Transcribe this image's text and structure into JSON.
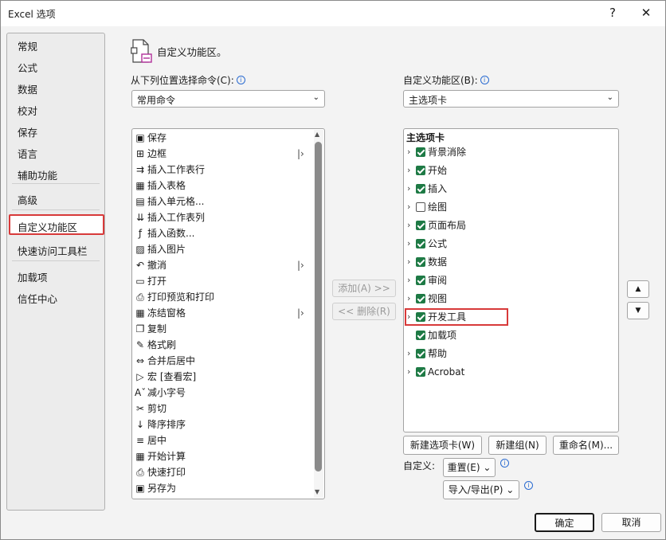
{
  "window": {
    "title": "Excel 选项",
    "help": "?",
    "close": "✕"
  },
  "nav": {
    "items": [
      "常规",
      "公式",
      "数据",
      "校对",
      "保存",
      "语言",
      "辅助功能",
      "高级",
      "自定义功能区",
      "快速访问工具栏",
      "加载项",
      "信任中心"
    ],
    "selected": "自定义功能区"
  },
  "header": {
    "title": "自定义功能区。"
  },
  "left": {
    "label": "从下列位置选择命令(C):",
    "combo_value": "常用命令",
    "commands": [
      {
        "label": "保存",
        "icon": "save-icon",
        "glyph": "▣",
        "arrow": false
      },
      {
        "label": "边框",
        "icon": "border-icon",
        "glyph": "⊞",
        "arrow": true
      },
      {
        "label": "插入工作表行",
        "icon": "insert-row-icon",
        "glyph": "⇉",
        "arrow": false
      },
      {
        "label": "插入表格",
        "icon": "insert-table-icon",
        "glyph": "▦",
        "arrow": false
      },
      {
        "label": "插入单元格...",
        "icon": "insert-cells-icon",
        "glyph": "▤",
        "arrow": false
      },
      {
        "label": "插入工作表列",
        "icon": "insert-column-icon",
        "glyph": "⇊",
        "arrow": false
      },
      {
        "label": "插入函数...",
        "icon": "function-icon",
        "glyph": "ƒ",
        "arrow": false
      },
      {
        "label": "插入图片",
        "icon": "picture-icon",
        "glyph": "▨",
        "arrow": false
      },
      {
        "label": "撤消",
        "icon": "undo-icon",
        "glyph": "↶",
        "arrow": true
      },
      {
        "label": "打开",
        "icon": "open-icon",
        "glyph": "▭",
        "arrow": false
      },
      {
        "label": "打印预览和打印",
        "icon": "print-preview-icon",
        "glyph": "⎙",
        "arrow": false
      },
      {
        "label": "冻结窗格",
        "icon": "freeze-panes-icon",
        "glyph": "▦",
        "arrow": true
      },
      {
        "label": "复制",
        "icon": "copy-icon",
        "glyph": "❐",
        "arrow": false
      },
      {
        "label": "格式刷",
        "icon": "format-painter-icon",
        "glyph": "✎",
        "arrow": false
      },
      {
        "label": "合并后居中",
        "icon": "merge-center-icon",
        "glyph": "⇔",
        "arrow": false
      },
      {
        "label": "宏 [查看宏]",
        "icon": "macro-icon",
        "glyph": "▷",
        "arrow": false
      },
      {
        "label": "减小字号",
        "icon": "decrease-font-icon",
        "glyph": "Aˇ",
        "arrow": false
      },
      {
        "label": "剪切",
        "icon": "cut-icon",
        "glyph": "✂",
        "arrow": false
      },
      {
        "label": "降序排序",
        "icon": "sort-descending-icon",
        "glyph": "↓",
        "arrow": false
      },
      {
        "label": "居中",
        "icon": "center-align-icon",
        "glyph": "≡",
        "arrow": false
      },
      {
        "label": "开始计算",
        "icon": "calculate-icon",
        "glyph": "▦",
        "arrow": false
      },
      {
        "label": "快速打印",
        "icon": "quick-print-icon",
        "glyph": "⎙",
        "arrow": false
      },
      {
        "label": "另存为",
        "icon": "save-as-icon",
        "glyph": "▣",
        "arrow": false
      }
    ]
  },
  "middle": {
    "add": "添加(A) >>",
    "remove": "<< 删除(R)"
  },
  "right": {
    "label": "自定义功能区(B):",
    "combo_value": "主选项卡",
    "list_header": "主选项卡",
    "tabs": [
      {
        "label": "背景消除",
        "checked": true
      },
      {
        "label": "开始",
        "checked": true
      },
      {
        "label": "插入",
        "checked": true
      },
      {
        "label": "绘图",
        "checked": false
      },
      {
        "label": "页面布局",
        "checked": true
      },
      {
        "label": "公式",
        "checked": true
      },
      {
        "label": "数据",
        "checked": true
      },
      {
        "label": "审阅",
        "checked": true
      },
      {
        "label": "视图",
        "checked": true
      },
      {
        "label": "开发工具",
        "checked": true
      },
      {
        "label": "加载项",
        "checked": true
      },
      {
        "label": "帮助",
        "checked": true
      },
      {
        "label": "Acrobat",
        "checked": true
      }
    ],
    "new_tab": "新建选项卡(W)",
    "new_group": "新建组(N)",
    "rename": "重命名(M)...",
    "customize_label": "自定义:",
    "reset": "重置(E) ⌄",
    "import_export": "导入/导出(P) ⌄"
  },
  "footer": {
    "ok": "确定",
    "cancel": "取消"
  },
  "colors": {
    "checkbox": "#1e7a45",
    "highlight": "#d83a3a"
  }
}
